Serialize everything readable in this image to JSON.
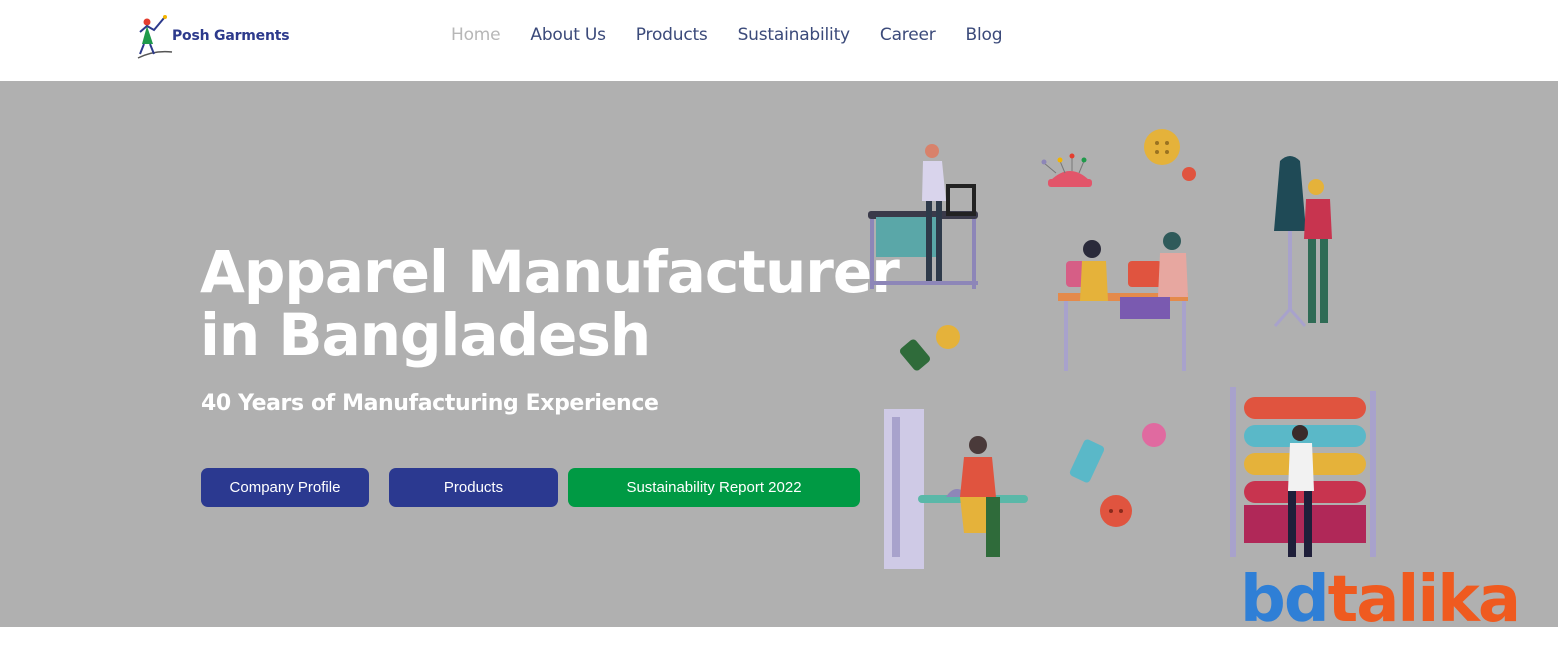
{
  "brand": {
    "name": "Posh Garments"
  },
  "nav": {
    "items": [
      {
        "label": "Home",
        "active": true
      },
      {
        "label": "About Us",
        "active": false
      },
      {
        "label": "Products",
        "active": false
      },
      {
        "label": "Sustainability",
        "active": false
      },
      {
        "label": "Career",
        "active": false
      },
      {
        "label": "Blog",
        "active": false
      }
    ]
  },
  "hero": {
    "title_line1": "Apparel Manufacturer",
    "title_line2": "in Bangladesh",
    "subtitle": "40 Years of Manufacturing Experience",
    "buttons": {
      "company_profile": "Company Profile",
      "products": "Products",
      "sustainability_report": "Sustainability Report 2022"
    }
  },
  "watermark": {
    "part1": "bd",
    "part2": "talika"
  },
  "colors": {
    "primary_button": "#2b3990",
    "report_button": "#009a44",
    "hero_overlay": "#b0b0b0",
    "nav_text": "#3b4a7a",
    "nav_active": "#b7b7b7",
    "watermark_blue": "#2f7fd6",
    "watermark_orange": "#ef5a1f"
  },
  "icons": {
    "logo": "dancing-figure-logo-icon",
    "illustration": "garment-workers-illustration"
  }
}
